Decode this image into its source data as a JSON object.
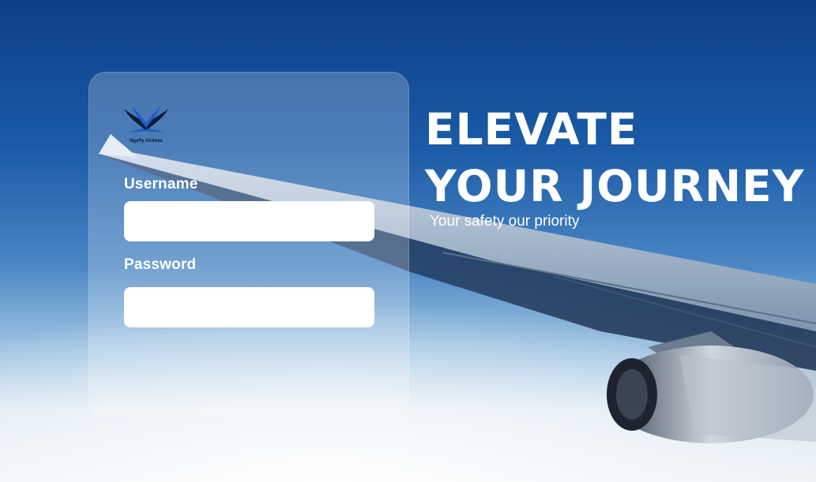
{
  "brand": {
    "name": "Ngefly Airlines",
    "logo_icon": "bird-wings-logo"
  },
  "login": {
    "username_label": "Username",
    "username_value": "",
    "password_label": "Password",
    "password_value": ""
  },
  "hero": {
    "headline_line1": "ELEVATE",
    "headline_line2": "YOUR JOURNEY",
    "tagline": "Your safety our priority"
  },
  "colors": {
    "sky_top": "#0d3f86",
    "sky_mid": "#4a86c3",
    "clouds": "#eef3f7",
    "text": "#ffffff"
  }
}
